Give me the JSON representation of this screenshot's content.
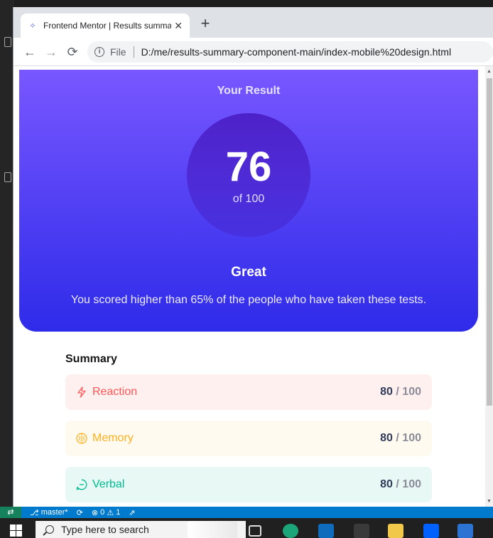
{
  "browser": {
    "tab_title": "Frontend Mentor | Results summary component",
    "tab_close": "✕",
    "new_tab": "+",
    "back": "←",
    "forward": "→",
    "reload": "⟳",
    "info_icon_glyph": "i",
    "file_label": "File",
    "url": "D:/me/results-summary-component-main/index-mobile%20design.html"
  },
  "result": {
    "title": "Your Result",
    "score": "76",
    "score_of": "of 100",
    "grade": "Great",
    "description": "You scored higher than 65% of the people who have taken these tests."
  },
  "summary": {
    "title": "Summary",
    "items": [
      {
        "label": "Reaction",
        "score": "80",
        "sep": " / ",
        "total": "100",
        "color": "#ff5757",
        "icon": "lightning-icon"
      },
      {
        "label": "Memory",
        "score": "80",
        "sep": " / ",
        "total": "100",
        "color": "#ffb01f",
        "icon": "brain-icon"
      },
      {
        "label": "Verbal",
        "score": "80",
        "sep": " / ",
        "total": "100",
        "color": "#00bb8f",
        "icon": "chat-icon"
      }
    ]
  },
  "statusbar": {
    "branch": "master*",
    "errors": "0",
    "warnings": "1"
  },
  "taskbar": {
    "search_placeholder": "Type here to search"
  },
  "colors": {
    "gradient_top": "#7857ff",
    "gradient_bottom": "#2e2be9",
    "statusbar": "#007acc",
    "taskbar": "#202020"
  }
}
